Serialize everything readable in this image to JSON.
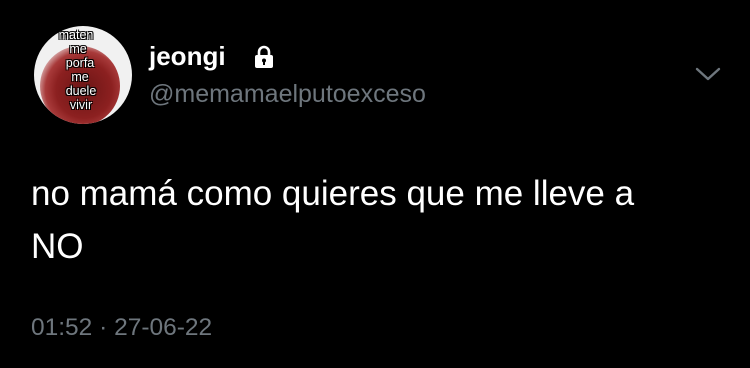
{
  "tweet": {
    "avatar": {
      "caption_lines": [
        "maten",
        "me",
        "porfa",
        "me",
        "duele",
        "vivir"
      ]
    },
    "author": {
      "display_name": "jeongi",
      "handle": "@memamaelputoexceso",
      "protected": true,
      "lock_icon": "lock-icon"
    },
    "more_icon": "chevron-down-icon",
    "text": "no mamá como quieres que me lleve a\nNO",
    "time": "01:52",
    "separator": "·",
    "date": "27-06-22",
    "colors": {
      "background": "#000000",
      "primary_text": "#ffffff",
      "secondary_text": "#6e767d"
    }
  }
}
